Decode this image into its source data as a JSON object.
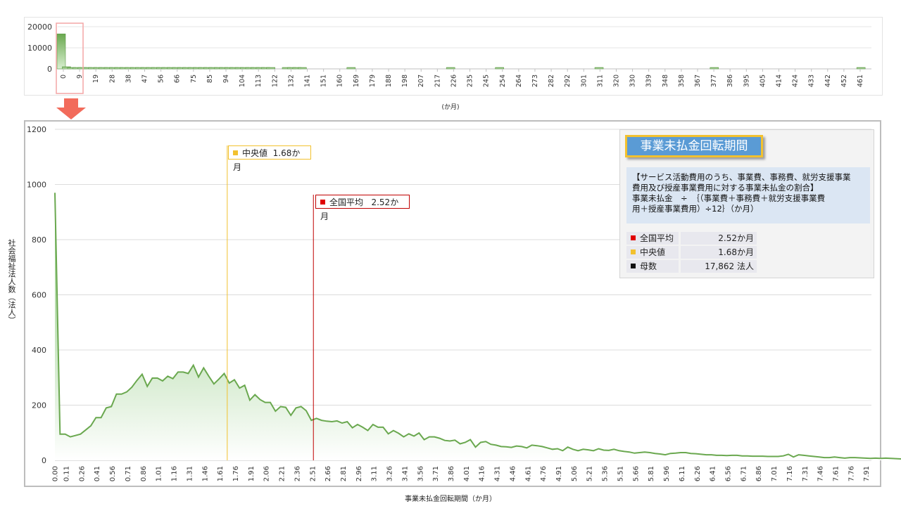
{
  "chart_data": [
    {
      "type": "bar",
      "role": "overview",
      "xlabel": "(か月)",
      "ylim": [
        0,
        20000
      ],
      "yticks": [
        0,
        10000,
        20000
      ],
      "x_tick_labels": [
        "0",
        "9",
        "19",
        "28",
        "38",
        "47",
        "56",
        "66",
        "75",
        "85",
        "94",
        "104",
        "113",
        "122",
        "132",
        "141",
        "151",
        "160",
        "169",
        "179",
        "188",
        "198",
        "207",
        "217",
        "226",
        "235",
        "245",
        "254",
        "264",
        "273",
        "282",
        "292",
        "301",
        "311",
        "320",
        "330",
        "339",
        "348",
        "358",
        "367",
        "377",
        "386",
        "395",
        "405",
        "414",
        "424",
        "433",
        "442",
        "452",
        "461"
      ],
      "bars": [
        {
          "x": 0,
          "value": 16600
        },
        {
          "x": 3,
          "value": 1000
        },
        {
          "x": 6,
          "value": 380
        },
        {
          "x": 9,
          "value": 300
        },
        {
          "x": 12,
          "value": 260
        },
        {
          "x": 15,
          "value": 230
        },
        {
          "x": 18,
          "value": 210
        },
        {
          "x": 21,
          "value": 200
        },
        {
          "x": 24,
          "value": 190
        },
        {
          "x": 27,
          "value": 180
        },
        {
          "x": 30,
          "value": 170
        },
        {
          "x": 33,
          "value": 165
        },
        {
          "x": 36,
          "value": 160
        },
        {
          "x": 39,
          "value": 155
        },
        {
          "x": 42,
          "value": 150
        },
        {
          "x": 45,
          "value": 145
        },
        {
          "x": 48,
          "value": 140
        },
        {
          "x": 51,
          "value": 135
        },
        {
          "x": 54,
          "value": 130
        },
        {
          "x": 57,
          "value": 125
        },
        {
          "x": 60,
          "value": 120
        },
        {
          "x": 63,
          "value": 115
        },
        {
          "x": 66,
          "value": 110
        },
        {
          "x": 69,
          "value": 105
        },
        {
          "x": 72,
          "value": 100
        },
        {
          "x": 75,
          "value": 100
        },
        {
          "x": 78,
          "value": 95
        },
        {
          "x": 81,
          "value": 95
        },
        {
          "x": 84,
          "value": 90
        },
        {
          "x": 87,
          "value": 90
        },
        {
          "x": 90,
          "value": 85
        },
        {
          "x": 93,
          "value": 85
        },
        {
          "x": 96,
          "value": 80
        },
        {
          "x": 99,
          "value": 80
        },
        {
          "x": 102,
          "value": 75
        },
        {
          "x": 105,
          "value": 75
        },
        {
          "x": 108,
          "value": 70
        },
        {
          "x": 111,
          "value": 70
        },
        {
          "x": 114,
          "value": 65
        },
        {
          "x": 117,
          "value": 65
        },
        {
          "x": 120,
          "value": 60
        },
        {
          "x": 129,
          "value": 60
        },
        {
          "x": 132,
          "value": 60
        },
        {
          "x": 135,
          "value": 60
        },
        {
          "x": 138,
          "value": 60
        },
        {
          "x": 166,
          "value": 150
        },
        {
          "x": 223,
          "value": 150
        },
        {
          "x": 251,
          "value": 160
        },
        {
          "x": 308,
          "value": 150
        },
        {
          "x": 374,
          "value": 150
        },
        {
          "x": 458,
          "value": 170
        }
      ],
      "highlight_range": [
        0,
        9
      ]
    },
    {
      "type": "area",
      "role": "detail",
      "xlabel": "事業未払金回転期間（か月）",
      "ylabel": "社会福祉法人数（法人）",
      "ylim": [
        0,
        1200
      ],
      "yticks": [
        0,
        200,
        400,
        600,
        800,
        1000,
        1200
      ],
      "xlim": [
        0,
        7.96
      ],
      "x_tick_labels": [
        "0.00",
        "0.11",
        "0.26",
        "0.41",
        "0.56",
        "0.71",
        "0.86",
        "1.01",
        "1.16",
        "1.31",
        "1.46",
        "1.61",
        "1.76",
        "1.91",
        "2.06",
        "2.21",
        "2.36",
        "2.51",
        "2.66",
        "2.81",
        "2.96",
        "3.11",
        "3.26",
        "3.41",
        "3.56",
        "3.71",
        "3.86",
        "4.01",
        "4.16",
        "4.31",
        "4.46",
        "4.61",
        "4.76",
        "4.91",
        "5.06",
        "5.21",
        "5.36",
        "5.51",
        "5.66",
        "5.81",
        "5.96",
        "6.11",
        "6.26",
        "6.41",
        "6.56",
        "6.71",
        "6.86",
        "7.01",
        "7.16",
        "7.31",
        "7.46",
        "7.61",
        "7.76",
        "7.91"
      ],
      "x_start": 0.0,
      "x_step": 0.05,
      "values": [
        970,
        95,
        95,
        85,
        90,
        95,
        110,
        125,
        155,
        155,
        190,
        195,
        240,
        240,
        248,
        265,
        290,
        312,
        268,
        298,
        298,
        288,
        305,
        296,
        320,
        320,
        315,
        345,
        302,
        335,
        305,
        277,
        295,
        315,
        280,
        292,
        262,
        272,
        218,
        238,
        220,
        210,
        210,
        178,
        195,
        192,
        163,
        190,
        195,
        180,
        145,
        152,
        145,
        142,
        140,
        143,
        135,
        140,
        118,
        130,
        120,
        108,
        130,
        120,
        120,
        96,
        108,
        98,
        85,
        96,
        88,
        99,
        75,
        85,
        85,
        80,
        72,
        70,
        73,
        60,
        65,
        75,
        48,
        65,
        68,
        58,
        55,
        50,
        49,
        47,
        52,
        50,
        45,
        55,
        53,
        50,
        45,
        40,
        42,
        35,
        48,
        40,
        35,
        40,
        38,
        35,
        42,
        37,
        36,
        40,
        35,
        32,
        30,
        26,
        28,
        30,
        28,
        25,
        23,
        20,
        25,
        26,
        28,
        28,
        25,
        24,
        22,
        20,
        20,
        18,
        18,
        17,
        18,
        18,
        16,
        16,
        15,
        15,
        15,
        14,
        14,
        14,
        16,
        22,
        12,
        20,
        18,
        16,
        14,
        12,
        10,
        10,
        12,
        10,
        8,
        10,
        10,
        9,
        8,
        7,
        8,
        7,
        8,
        7,
        6,
        5,
        7,
        6,
        6,
        6,
        5,
        5,
        5,
        5,
        4,
        5,
        5,
        4,
        3,
        4,
        4,
        3,
        3,
        3,
        2
      ]
    }
  ],
  "annotations": {
    "median": {
      "label": "中央値",
      "value_text": "1.68か月",
      "x": 1.68,
      "color": "#f2c12e"
    },
    "mean": {
      "label": "全国平均",
      "value_text": "2.52か月",
      "x": 2.52,
      "color": "#c00000"
    }
  },
  "info": {
    "title": "事業未払金回転期間",
    "formula_line1": "【サービス活動費用のうち、事業費、事務費、就労支援事業",
    "formula_line2": "費用及び授産事業費用に対する事業未払金の割合】",
    "formula_line3": "事業未払金　÷　｛（事業費＋事務費＋就労支援事業費",
    "formula_line4": "用＋授産事業費用）÷12｝（か月）",
    "stats": [
      {
        "label": "全国平均",
        "value": "2.52か月",
        "color": "#e00000"
      },
      {
        "label": "中央値",
        "value": "1.68か月",
        "color": "#f2c12e"
      },
      {
        "label": "母数",
        "value": "17,862 法人",
        "color": "#111111"
      }
    ]
  },
  "colors": {
    "series": "#6aa84f",
    "fill_top": "#7cc16a",
    "fill_bottom": "#ffffff",
    "highlight_box": "#f4a6a6",
    "arrow": "#f26b5b",
    "info_title_bg": "#5a9bd5",
    "info_title_border": "#f2c12e"
  }
}
